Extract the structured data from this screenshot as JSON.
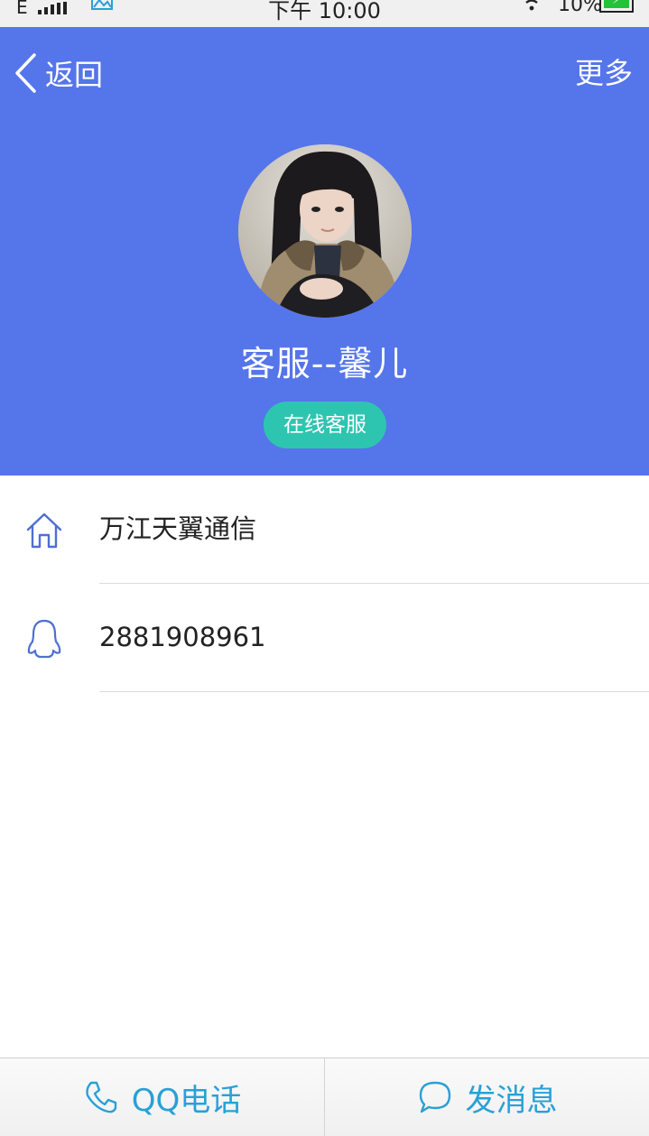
{
  "status_bar": {
    "carrier": "E",
    "time": "下午 10:00",
    "battery_percent": "10%"
  },
  "nav": {
    "back_label": "返回",
    "more_label": "更多"
  },
  "profile": {
    "name": "客服--馨儿",
    "badge": "在线客服"
  },
  "info": {
    "company": "万江天翼通信",
    "qq_number": "2881908961"
  },
  "actions": {
    "call_label": "QQ电话",
    "message_label": "发消息"
  },
  "colors": {
    "header_bg": "#5575ea",
    "badge_bg": "#2ec5b0",
    "action_text": "#29a0d6",
    "icon_stroke": "#4f6fd0"
  }
}
